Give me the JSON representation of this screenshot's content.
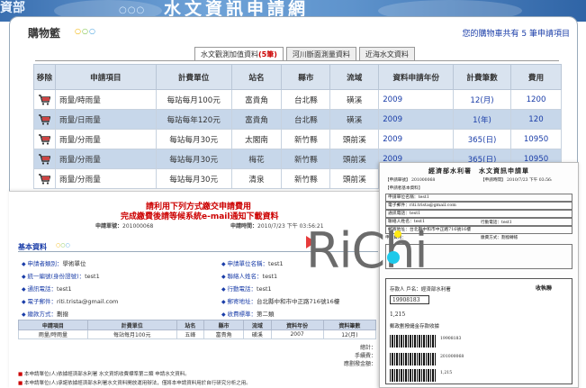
{
  "banner": {
    "left_text": "資部",
    "title": "水文資訊申請網",
    "dots": "○○○"
  },
  "cart": {
    "title": "購物籃",
    "title_dots": "○○○",
    "summary": "您的購物車共有 5 筆申請項目",
    "tabs": [
      {
        "label": "水文觀測加值資料",
        "count": "(5筆)",
        "active": true
      },
      {
        "label": "河川斷面測量資料",
        "count": "",
        "active": false
      },
      {
        "label": "近海水文資料",
        "count": "",
        "active": false
      }
    ],
    "headers": [
      "移除",
      "申請項目",
      "計費單位",
      "站名",
      "縣市",
      "流域",
      "資料申請年份",
      "計費筆數",
      "費用"
    ],
    "rows": [
      {
        "item": "雨量/時雨量",
        "unit": "每站每月100元",
        "station": "富貴角",
        "county": "台北縣",
        "basin": "磺溪",
        "year": "2009",
        "count": "12(月)",
        "fee": "1200"
      },
      {
        "item": "雨量/日雨量",
        "unit": "每站每年120元",
        "station": "富貴角",
        "county": "台北縣",
        "basin": "磺溪",
        "year": "2009",
        "count": "1(年)",
        "fee": "120"
      },
      {
        "item": "雨量/分雨量",
        "unit": "每站每月30元",
        "station": "太閣南",
        "county": "新竹縣",
        "basin": "頭前溪",
        "year": "2009",
        "count": "365(日)",
        "fee": "10950"
      },
      {
        "item": "雨量/分雨量",
        "unit": "每站每月30元",
        "station": "梅花",
        "county": "新竹縣",
        "basin": "頭前溪",
        "year": "2009",
        "count": "365(日)",
        "fee": "10950"
      },
      {
        "item": "雨量/分雨量",
        "unit": "每站每月30元",
        "station": "清泉",
        "county": "新竹縣",
        "basin": "頭前溪",
        "year": "2009",
        "count": "365(日)",
        "fee": "10950"
      }
    ]
  },
  "payment": {
    "notice1": "請利用下列方式繳交申請費用",
    "notice2": "完成繳費後請等候系統e-mail通知下載資料",
    "order_label": "申請單號：",
    "order_value": "201000068",
    "time_label": "申請時間：",
    "time_value": "2010/7/23 下午 03:56:21",
    "basic_title": "基本資料",
    "basic_dots": "○○○",
    "fields_left": [
      {
        "label": "申請者類別：",
        "value": "學術單位"
      },
      {
        "label": "統一編號(身份證號)：",
        "value": "test1"
      },
      {
        "label": "通訊電話：",
        "value": "test1"
      },
      {
        "label": "電子郵件：",
        "value": "riti.trista@gmail.com"
      },
      {
        "label": "繳款方式：",
        "value": "劃撥"
      }
    ],
    "fields_right": [
      {
        "label": "申請單位名稱：",
        "value": "test1"
      },
      {
        "label": "聯絡人姓名：",
        "value": "test1"
      },
      {
        "label": "行動電話：",
        "value": "test1"
      },
      {
        "label": "郵寄地址：",
        "value": "台北縣中和市中正路716號16樓"
      },
      {
        "label": "收費標準：",
        "value": "第二類"
      }
    ],
    "mini_headers": [
      "申請項目",
      "計費單位",
      "站名",
      "縣市",
      "流域",
      "資料年份",
      "資料筆數"
    ],
    "mini_row": [
      "雨量/時雨量",
      "每站每月100元",
      "五峰",
      "富貴角",
      "磺溪",
      "2007",
      "12(月)"
    ],
    "totals": [
      "總計：",
      "手續費：",
      "應劃撥金額："
    ],
    "foot1": "本申請單位(人)依據經濟部水利署 水文資訊收費標準第二類 申請水文資料。",
    "foot2": "本申請單位(人)承諾依據經濟部水利署水文資料開放運用辦法，僅將本申請資料用於自行研究分析之用。"
  },
  "logo": {
    "text": "RiChi",
    "play_color": "#e63c3c",
    "dot_colors": [
      "#1ec9ea",
      "#ffe814"
    ]
  },
  "form": {
    "title": "經濟部水利署　水文資訊申請單",
    "order_tag": "【申請單號】",
    "order_value": "201000068",
    "time_tag": "【申請時間】",
    "time_value": "2010/7/23 下午 03:56:",
    "basic_tag": "【申請者基本資料】",
    "rows": [
      "申請單位名稱：test1",
      "電子郵件：riti.trista@gmail.com",
      "通訊電話：test1",
      "聯絡人姓名：test1",
      "郵寄地址：台北縣中和市中正路716號16樓"
    ],
    "mobile": "行動電話：test1",
    "pay": "繳費方式：劃撥轉帳",
    "fee_tag": "申請費用：",
    "slip_title": "存款人 戶名：經濟部水利署",
    "slip_receipt": "收執聯",
    "slip_acct": "19908183",
    "slip_acct2": "1,215",
    "slip_label": "郵政劃撥儲金存款收據",
    "slip_code": "19908183",
    "slip_bar_num1": "201000068",
    "slip_bar_num2": "1,215"
  }
}
